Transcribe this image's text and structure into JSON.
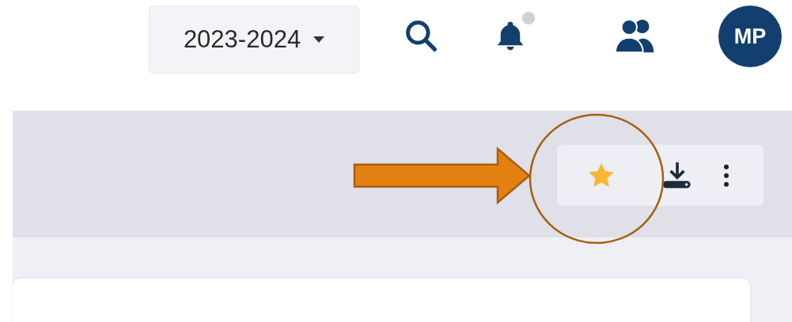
{
  "header": {
    "year_selector": {
      "value": "2023-2024"
    },
    "notifications": {
      "unread": true
    },
    "avatar": {
      "initials": "MP"
    }
  },
  "toolbar": {
    "favorite": {
      "selected": true
    }
  },
  "annotation": {
    "arrow": true,
    "highlight": true
  }
}
